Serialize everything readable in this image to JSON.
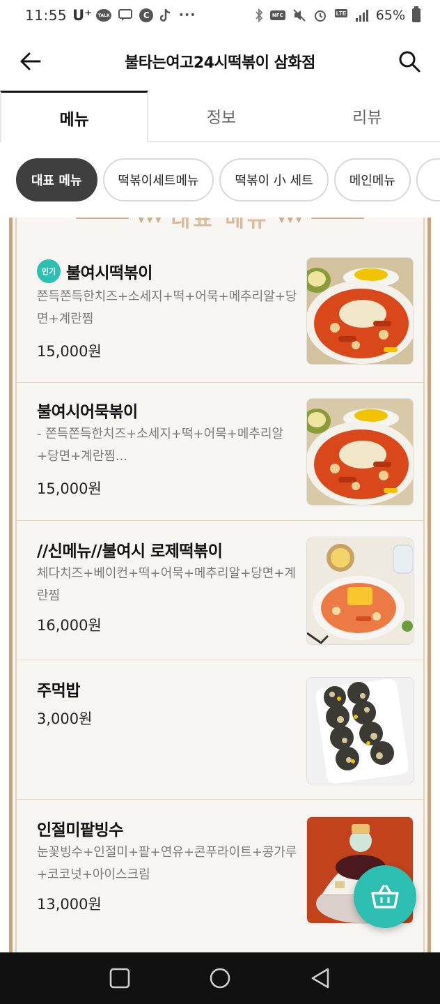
{
  "status": {
    "time": "11:55",
    "carrier": "U⁺",
    "battery": "65%"
  },
  "header": {
    "title": "불타는여고24시떡볶이 삼화점"
  },
  "tabs": [
    {
      "label": "메뉴",
      "active": true
    },
    {
      "label": "정보",
      "active": false
    },
    {
      "label": "리뷰",
      "active": false
    }
  ],
  "chips": [
    {
      "label": "대표 메뉴",
      "active": true
    },
    {
      "label": "떡볶이세트메뉴",
      "active": false
    },
    {
      "label": "떡볶이 小 세트",
      "active": false
    },
    {
      "label": "메인메뉴",
      "active": false
    }
  ],
  "board": {
    "banner": "대표 메뉴"
  },
  "menu": [
    {
      "badge": "인기",
      "name": "불여시떡볶이",
      "desc": "쫀득쫀득한치즈+소세지+떡+어묵+메추리알+당면+계란찜",
      "price": "15,000원"
    },
    {
      "badge": "",
      "name": "불여시어묵볶이",
      "desc": "- 쫀득쫀득한치즈+소세지+떡+어묵+메추리알+당면+계란찜...",
      "price": "15,000원"
    },
    {
      "badge": "",
      "name": "//신메뉴//불여시 로제떡볶이",
      "desc": "체다치즈+베이컨+떡+어묵+메추리알+당면+계란찜",
      "price": "16,000원"
    },
    {
      "badge": "",
      "name": "주먹밥",
      "desc": "",
      "price": "3,000원"
    },
    {
      "badge": "",
      "name": "인절미팥빙수",
      "desc": "눈꽃빙수+인절미+팥+연유+콘푸라이트+콩가루+코코넛+아이스크림",
      "price": "13,000원"
    }
  ],
  "colors": {
    "accent": "#2cbfb1",
    "board_border": "#c6a37c",
    "chip_active": "#3f3f3f"
  }
}
